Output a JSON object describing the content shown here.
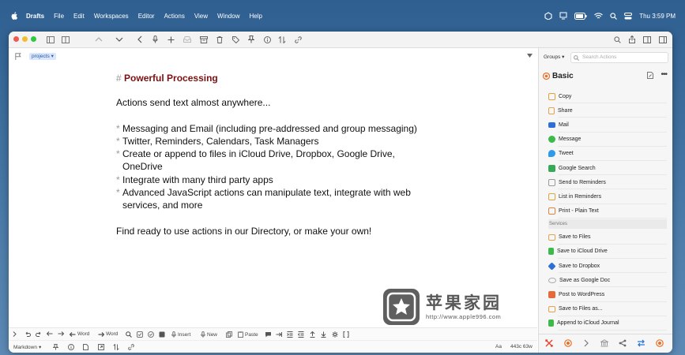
{
  "menubar": {
    "app_name": "Drafts",
    "menus": [
      "File",
      "Edit",
      "Workspaces",
      "Editor",
      "Actions",
      "View",
      "Window",
      "Help"
    ],
    "clock": "Thu 3:59 PM"
  },
  "editor": {
    "tag": "projects",
    "heading_hash": "#",
    "heading": "Powerful Processing",
    "intro": "Actions send text almost anywhere...",
    "bullet_marker": "*",
    "bullets": [
      "Messaging and Email (including pre-addressed and group messaging)",
      "Twitter, Reminders, Calendars, Task Managers",
      "Create or append to files in iCloud Drive, Dropbox, Google Drive, OneDrive",
      "Integrate with many third party apps",
      "Advanced JavaScript actions can manipulate text, integrate with web services, and more"
    ],
    "closing": "Find ready to use actions in our Directory, or make your own!"
  },
  "watermark": {
    "title": "苹果家园",
    "url": "http://www.apple996.com"
  },
  "bottom_toolbar": {
    "word_back": "Word",
    "word_forward": "Word",
    "insert": "Insert",
    "new": "New",
    "paste": "Paste",
    "syntax": "Markdown",
    "font_label": "Aa",
    "stats": "443c 63w"
  },
  "actions_panel": {
    "groups_label": "Groups",
    "search_placeholder": "Search Actions",
    "group_name": "Basic",
    "actions": [
      {
        "label": "Copy",
        "color": "#e3a33a"
      },
      {
        "label": "Share",
        "color": "#e8a24a"
      },
      {
        "label": "Mail",
        "color": "#2e6fd6"
      },
      {
        "label": "Message",
        "color": "#3dbb4a"
      },
      {
        "label": "Tweet",
        "color": "#2d9be8"
      },
      {
        "label": "Google Search",
        "color": "#3aa957"
      },
      {
        "label": "Send to Reminders",
        "color": "#9a9a9a"
      },
      {
        "label": "List in Reminders",
        "color": "#e4a43c"
      },
      {
        "label": "Print - Plain Text",
        "color": "#e5843a"
      }
    ],
    "services_label": "Services",
    "services": [
      {
        "label": "Save to Files",
        "color": "#e8a24a"
      },
      {
        "label": "Save to iCloud Drive",
        "color": "#3dbb4a"
      },
      {
        "label": "Save to Dropbox",
        "color": "#2e6fd6"
      },
      {
        "label": "Save as Google Doc",
        "color": "#aaaaaa"
      },
      {
        "label": "Post to WordPress",
        "color": "#e56a3a"
      },
      {
        "label": "Save to Files as...",
        "color": "#e8a24a"
      },
      {
        "label": "Append to iCloud Journal",
        "color": "#3dbb4a"
      }
    ]
  }
}
